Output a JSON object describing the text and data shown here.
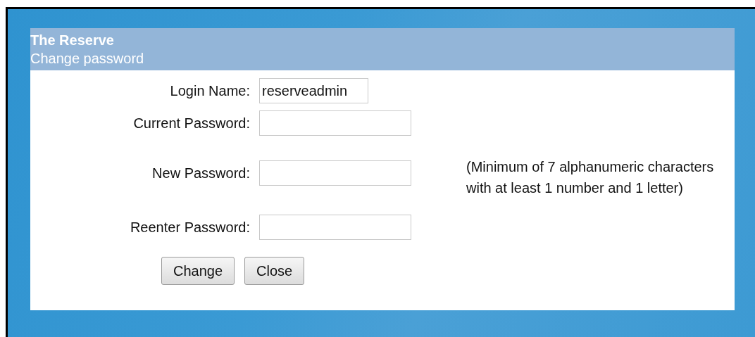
{
  "dialog": {
    "title": "The Reserve",
    "subtitle": "Change password"
  },
  "fields": [
    {
      "label": "Login Name:",
      "value": "reserveadmin"
    },
    {
      "label": "Current Password:"
    },
    {
      "label": "New Password:"
    },
    {
      "label": "Reenter Password:"
    }
  ],
  "note": "(Minimum of 7 alphanumeric characters with at least 1 number and 1 letter)",
  "buttons": [
    "Change",
    "Close"
  ]
}
